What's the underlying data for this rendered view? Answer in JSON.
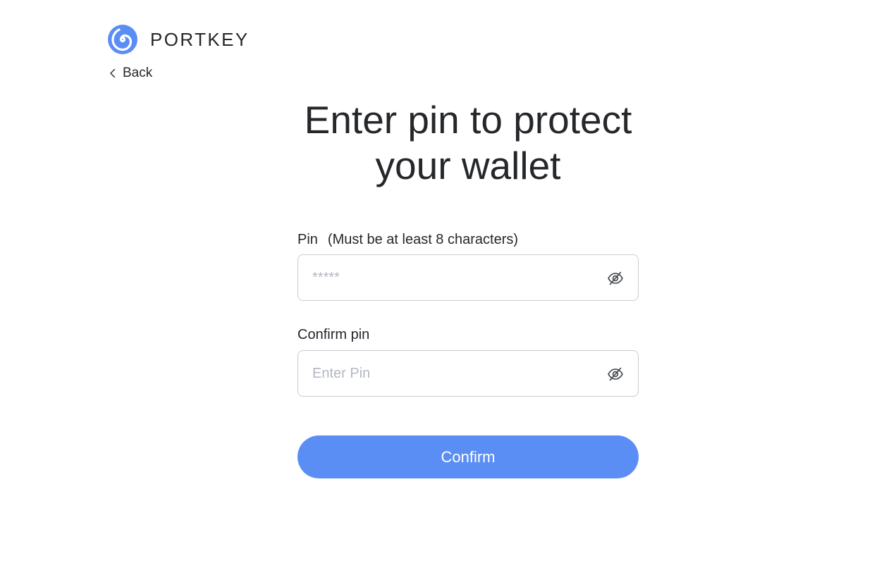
{
  "brand": {
    "name": "PORTKEY",
    "logo_icon": "spiral-logo-icon",
    "color": "#5b8ef4"
  },
  "nav": {
    "back_label": "Back",
    "back_icon": "chevron-left-icon"
  },
  "page": {
    "title_line1": "Enter pin to protect",
    "title_line2": "your wallet"
  },
  "form": {
    "pin": {
      "label": "Pin",
      "hint": "(Must be at least 8 characters)",
      "value": "",
      "placeholder": "*****",
      "toggle_icon": "eye-off-icon"
    },
    "confirm_pin": {
      "label": "Confirm pin",
      "value": "",
      "placeholder": "Enter Pin",
      "toggle_icon": "eye-off-icon"
    },
    "submit_label": "Confirm"
  },
  "colors": {
    "accent": "#5b8ef4",
    "text": "#25272a",
    "border": "#c9ccd3",
    "placeholder": "#b3b8c2"
  }
}
